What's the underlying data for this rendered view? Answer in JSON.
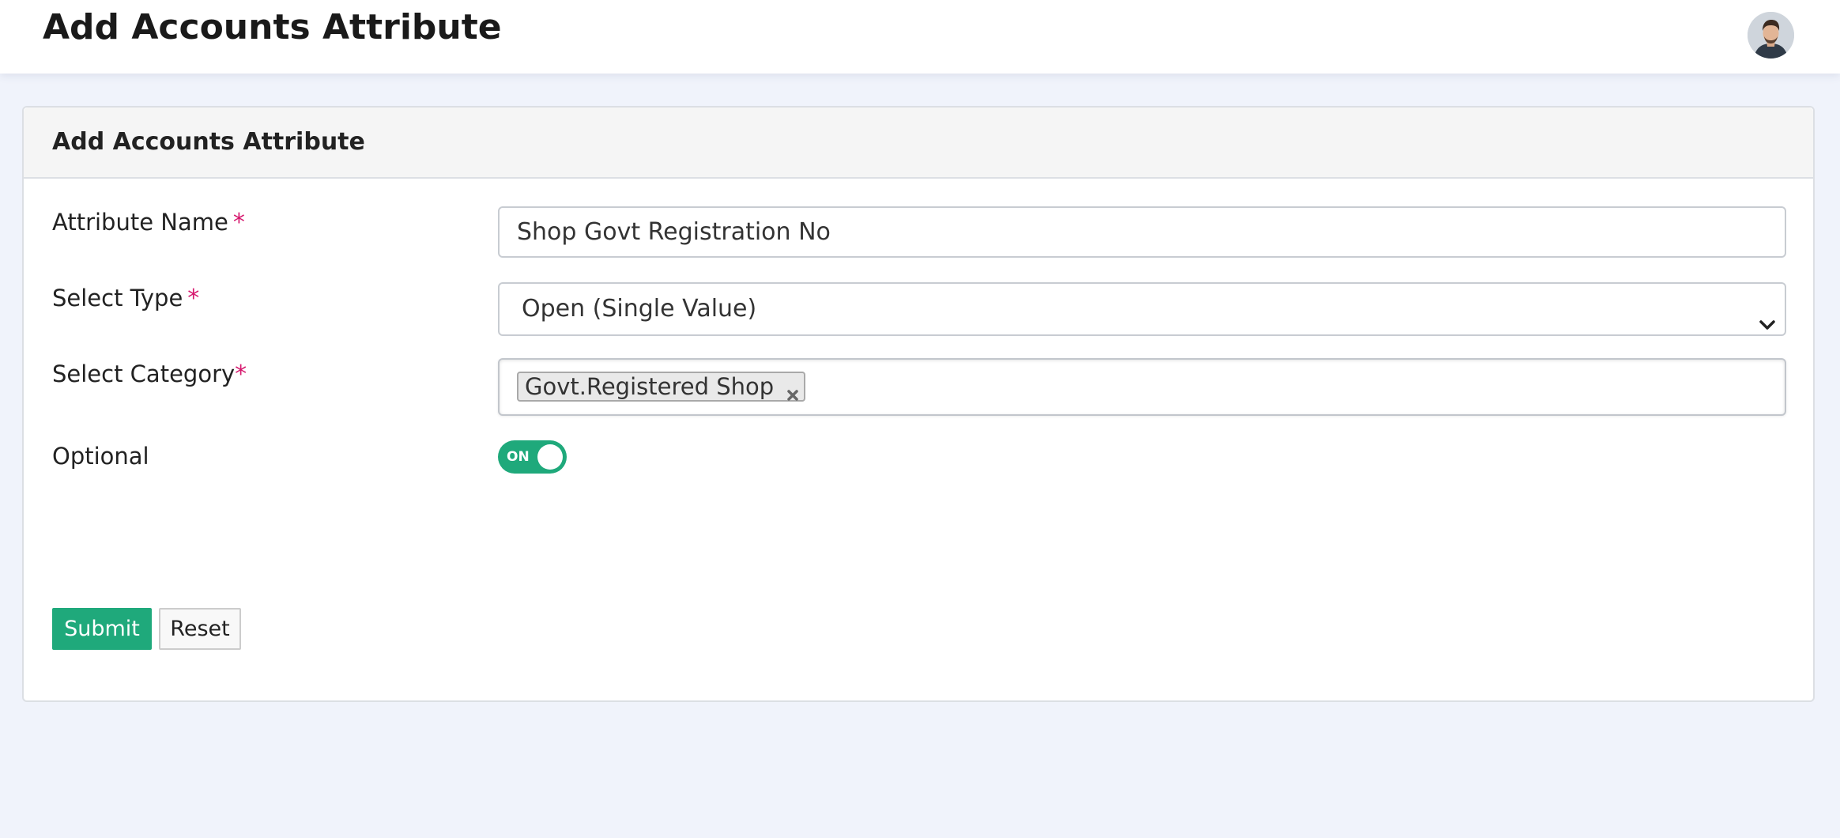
{
  "header": {
    "title": "Add Accounts Attribute"
  },
  "card": {
    "title": "Add Accounts Attribute"
  },
  "form": {
    "attribute_name": {
      "label": "Attribute Name",
      "required_marker": "*",
      "value": "Shop Govt Registration No"
    },
    "select_type": {
      "label": "Select Type",
      "required_marker": "*",
      "selected": "Open (Single Value)"
    },
    "select_category": {
      "label": "Select Category",
      "required_marker": "*",
      "tags": [
        "Govt.Registered Shop"
      ]
    },
    "optional": {
      "label": "Optional",
      "toggle_text": "ON",
      "state": "on"
    },
    "buttons": {
      "submit_label": "Submit",
      "reset_label": "Reset"
    }
  },
  "colors": {
    "accent": "#1fa97b",
    "required": "#d6196e",
    "page_background": "#f0f3fb"
  },
  "icons": {
    "avatar": "user-avatar",
    "select_arrow": "chevron-down-icon",
    "tag_remove": "close-icon"
  }
}
